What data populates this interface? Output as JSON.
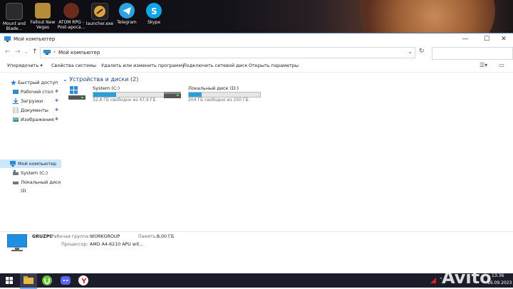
{
  "desktop": {
    "icons": [
      {
        "label": "Mount and Blade...",
        "icon": "mount-and-blade-icon",
        "color": "#2b2b2b"
      },
      {
        "label": "Fallout New Vegas",
        "icon": "fallout-new-vegas-icon",
        "color": "#b58d3a"
      },
      {
        "label": "ATOM RPG - Post-apoca...",
        "icon": "atom-rpg-icon",
        "color": "#6a2b1e"
      },
      {
        "label": "launcher.exe",
        "icon": "counter-strike-icon",
        "color": "#222222"
      },
      {
        "label": "Telegram",
        "icon": "telegram-icon",
        "color": "#2aa3de"
      },
      {
        "label": "Skype",
        "icon": "skype-icon",
        "color": "#0fa4e8"
      }
    ]
  },
  "window": {
    "title": "Мой компьютер",
    "controls": {
      "minimize": "—",
      "maximize": "☐",
      "close": "✕"
    },
    "address": {
      "path": "Мой компьютер",
      "separator": "›",
      "dropdown": "⌄",
      "refresh": "↻"
    },
    "search": {
      "placeholder": ""
    },
    "toolbar": [
      {
        "label": "Упорядочить ▾"
      },
      {
        "label": "Свойства системы"
      },
      {
        "label": "Удалить или изменить программу"
      },
      {
        "label": "Подключить сетевой диск"
      },
      {
        "label": "Открыть параметры"
      }
    ],
    "sidebar": [
      {
        "label": "Быстрый доступ",
        "icon": "star-icon",
        "pinned": false
      },
      {
        "label": "Рабочий стол",
        "icon": "desktop-folder-icon",
        "pinned": true
      },
      {
        "label": "Загрузки",
        "icon": "downloads-icon",
        "pinned": true
      },
      {
        "label": "Документы",
        "icon": "documents-icon",
        "pinned": true
      },
      {
        "label": "Изображения",
        "icon": "pictures-icon",
        "pinned": true
      },
      {
        "label": "Мой компьютер",
        "icon": "computer-icon",
        "pinned": false
      },
      {
        "label": "System (C:)",
        "icon": "drive-c-icon",
        "pinned": false
      },
      {
        "label": "Локальный диск (D",
        "icon": "drive-d-icon",
        "pinned": false
      }
    ],
    "pin_glyph": "✱",
    "group_header": "Устройства и диски (2)",
    "drives": [
      {
        "name": "System (C:)",
        "free_text": "32,8 ГБ свободно из 47,9 ГБ",
        "used_fraction": 0.32,
        "icon": "windows-drive-icon"
      },
      {
        "name": "Локальный диск (D:)",
        "free_text": "204 ГБ свободно из 250 ГБ",
        "used_fraction": 0.18,
        "icon": "hard-drive-icon"
      }
    ],
    "details": {
      "computer_name": "GRUZPC",
      "workgroup_label": "Рабочая группа:",
      "workgroup_value": "WORKGROUP",
      "memory_label": "Память:",
      "memory_value": "8,00 ГБ",
      "processor_label": "Процессор:",
      "processor_value": "AMD A4-6210 APU wit..."
    }
  },
  "taskbar": {
    "icons": [
      "start-icon",
      "file-explorer-icon",
      "utorrent-icon",
      "discord-icon",
      "yandex-browser-icon"
    ],
    "time": "13:36",
    "date": "16.09.2023",
    "watermark": "Avito"
  },
  "colors": {
    "accent": "#26a0da",
    "selection": "#cce8ff",
    "header_blue": "#1e3f8a",
    "taskbar": "#1b1d2b"
  }
}
